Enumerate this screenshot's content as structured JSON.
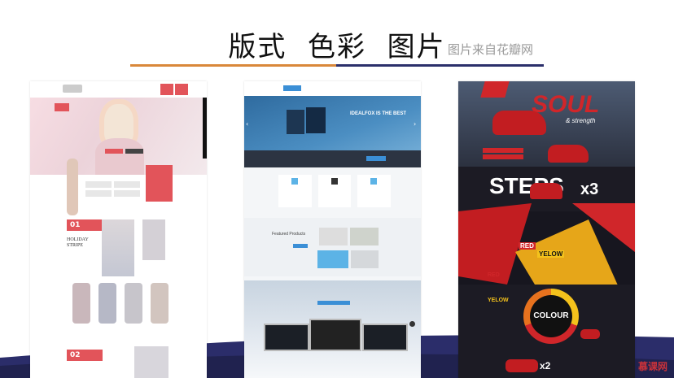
{
  "slide": {
    "title": "版式  色彩  图片",
    "subtitle": "图片来自花瓣网",
    "watermark": "慕课网"
  },
  "colors": {
    "rule_left": "#d9883a",
    "rule_right": "#2b2f6b",
    "fashion_red": "#e2545a",
    "tech_blue": "#3b8fd6",
    "poster_red": "#d0262a",
    "poster_yellow": "#f4c21c"
  },
  "mockups": {
    "fashion": {
      "section_1_number": "01",
      "section_1_heading": "HOLIDAY STRIPE",
      "section_2_number": "02"
    },
    "tech": {
      "hero_headline": "IDEALFOX IS THE BEST",
      "section_heading": "Featured Products"
    },
    "poster": {
      "word_soul": "SOUL",
      "word_strength": "& strength",
      "word_steps": "STEPS",
      "word_x3": "x3",
      "word_red_1": "RED",
      "word_yellow_1": "YELOW",
      "word_red_2": "RED",
      "word_yellow_2": "YELOW",
      "word_colour": "COLOUR",
      "word_x2": "x2"
    }
  }
}
